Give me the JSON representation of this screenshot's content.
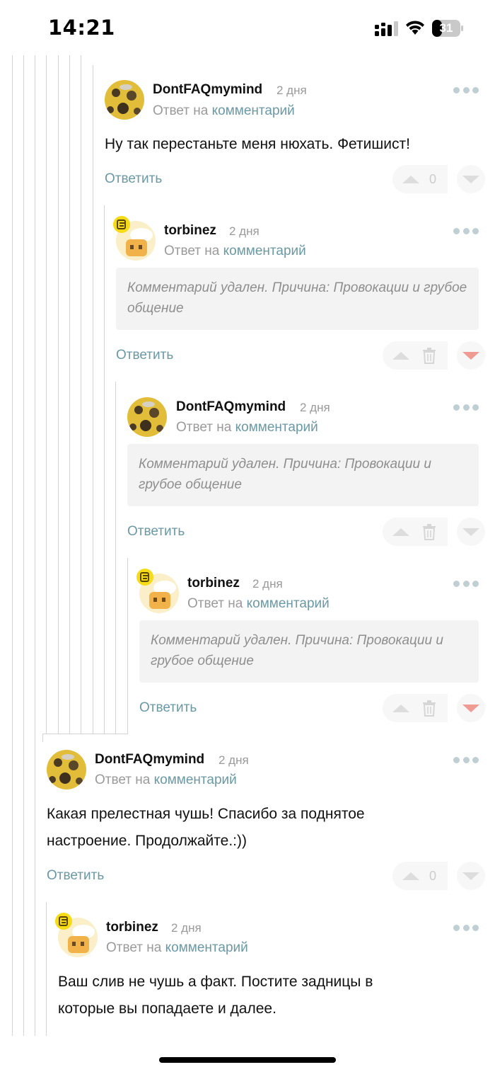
{
  "status_bar": {
    "time": "14:21",
    "battery": "31"
  },
  "reply_label": "Ответить",
  "reply_to_prefix": "Ответ на",
  "reply_to_link": "комментарий",
  "comments": [
    {
      "author": "DontFAQmymind",
      "date": "2 дня",
      "text": "Ну так перестаньте меня нюхать. Фетишист!",
      "votes": "0"
    },
    {
      "author": "torbinez",
      "date": "2 дня",
      "deleted_text": "Комментарий удален. Причина: Провокации и грубое общение"
    },
    {
      "author": "DontFAQmymind",
      "date": "2 дня",
      "deleted_text": "Комментарий удален. Причина: Провокации и грубое общение"
    },
    {
      "author": "torbinez",
      "date": "2 дня",
      "deleted_text": "Комментарий удален. Причина: Провокации и грубое общение"
    },
    {
      "author": "DontFAQmymind",
      "date": "2 дня",
      "text": "Какая прелестная чушь! Спасибо за поднятое настроение. Продолжайте.:))",
      "votes": "0"
    },
    {
      "author": "torbinez",
      "date": "2 дня",
      "text": "Ваш слив не чушь а факт. Постите задницы в которые вы попадаете и далее."
    }
  ],
  "colors": {
    "link": "#6a99a4",
    "downvote_active": "#f09a94",
    "badge": "#f6dc18"
  },
  "icons": [
    "signal-icon",
    "wifi-icon",
    "battery-icon",
    "more-dots-icon",
    "upvote-icon",
    "downvote-icon",
    "trash-icon",
    "user-badge-icon"
  ]
}
